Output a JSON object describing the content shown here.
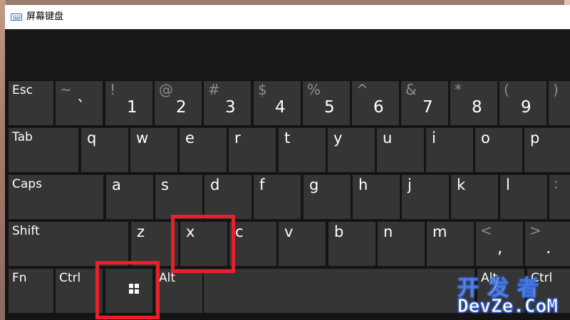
{
  "window": {
    "title": "屏幕键盘",
    "title_icon": "keyboard-icon"
  },
  "keyboard": {
    "row1": [
      {
        "name": "Esc"
      },
      {
        "upper": "~",
        "lower": "`"
      },
      {
        "upper": "!",
        "lower": "1"
      },
      {
        "upper": "@",
        "lower": "2"
      },
      {
        "upper": "#",
        "lower": "3"
      },
      {
        "upper": "$",
        "lower": "4"
      },
      {
        "upper": "%",
        "lower": "5"
      },
      {
        "upper": "^",
        "lower": "6"
      },
      {
        "upper": "&",
        "lower": "7"
      },
      {
        "upper": "*",
        "lower": "8"
      },
      {
        "upper": "(",
        "lower": "9"
      },
      {
        "upper": ")",
        "lower": ""
      }
    ],
    "row2": [
      {
        "name": "Tab"
      },
      {
        "letter": "q"
      },
      {
        "letter": "w"
      },
      {
        "letter": "e"
      },
      {
        "letter": "r"
      },
      {
        "letter": "t"
      },
      {
        "letter": "y"
      },
      {
        "letter": "u"
      },
      {
        "letter": "i"
      },
      {
        "letter": "o"
      },
      {
        "letter": "p"
      },
      {
        "letter": ""
      }
    ],
    "row3": [
      {
        "name": "Caps"
      },
      {
        "letter": "a"
      },
      {
        "letter": "s"
      },
      {
        "letter": "d"
      },
      {
        "letter": "f"
      },
      {
        "letter": "g"
      },
      {
        "letter": "h"
      },
      {
        "letter": "j"
      },
      {
        "letter": "k"
      },
      {
        "letter": "l"
      },
      {
        "upper": ":",
        "lower": ""
      }
    ],
    "row4": [
      {
        "name": "Shift"
      },
      {
        "letter": "z"
      },
      {
        "letter": "x"
      },
      {
        "letter": "c"
      },
      {
        "letter": "v"
      },
      {
        "letter": "b"
      },
      {
        "letter": "n"
      },
      {
        "letter": "m"
      },
      {
        "upper": "<",
        "lower": ","
      },
      {
        "upper": ">",
        "lower": "."
      }
    ],
    "row5": [
      {
        "name": "Fn"
      },
      {
        "name": "Ctrl"
      },
      {
        "icon": "windows-logo-icon"
      },
      {
        "name": "Alt"
      },
      {
        "name": ""
      },
      {
        "name": "Alt"
      },
      {
        "name": "Ctrl"
      }
    ]
  },
  "highlight_color": "#e8202a",
  "watermark": {
    "line1": "开发者",
    "line2": "DevZe.CoM"
  }
}
